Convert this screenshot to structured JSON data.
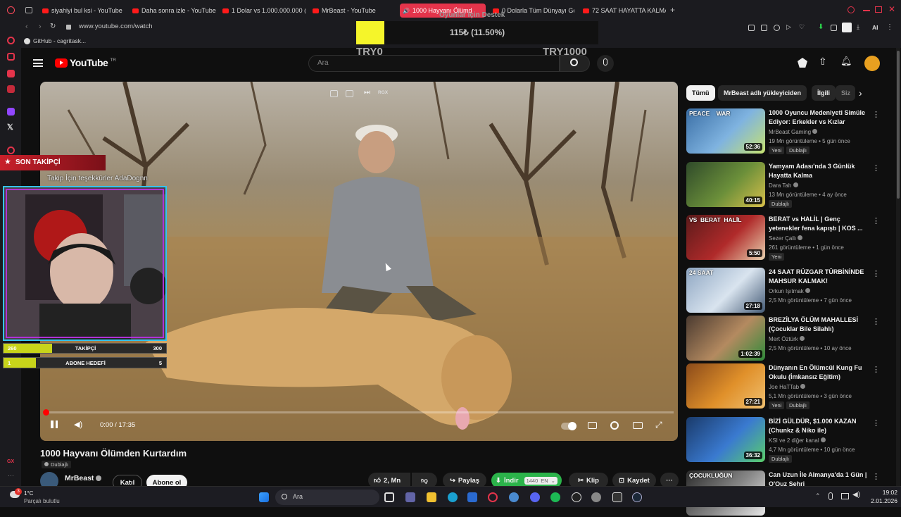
{
  "browser": {
    "tabs": [
      {
        "label": "siyahiyi bul ksi - YouTube"
      },
      {
        "label": "Daha sonra izle - YouTube"
      },
      {
        "label": "1 Dolar vs 1.000.000.000 ("
      },
      {
        "label": "MrBeast - YouTube"
      },
      {
        "label": "1000 Hayvanı Ölümd"
      },
      {
        "label": "0 Dolarla Tüm Dünyayı Ge"
      },
      {
        "label": "72 SAAT HAYATTA KALMA"
      }
    ],
    "url": "www.youtube.com/watch",
    "bookmark": "GitHub - cagritask...",
    "ai_label": "AI"
  },
  "donation": {
    "title": "Oyunlar İçin Destek",
    "amount": "115₺ (11.50%)",
    "progress": 0.115,
    "min_label": "TRY0",
    "max_label": "TRY1000"
  },
  "youtube": {
    "logo_text": "YouTube",
    "logo_region": "TR",
    "search_placeholder": "Ara",
    "video": {
      "title": "1000 Hayvanı Ölümden Kurtardım",
      "dub_label": "Dublajlı",
      "time": "0:00 / 17:35",
      "channel": "MrBeast",
      "join_label": "Katıl",
      "subscribe_label": "Abone ol",
      "likes": "2,  Mn",
      "share_label": "Paylaş",
      "download_label": "İndir",
      "download_quality": "1440",
      "download_lang": "EN",
      "clip_label": "Klip",
      "save_label": "Kaydet"
    },
    "chips": [
      "Tümü",
      "MrBeast adlı yükleyiciden",
      "İlgili",
      "Siz"
    ],
    "recommendations": [
      {
        "title": "1000 Oyuncu Medeniyeti Simüle Ediyor: Erkekler vs Kızlar",
        "channel": "MrBeast Gaming",
        "meta": "19 Mn görüntüleme • 5 gün önce",
        "badges": [
          "Yeni",
          "Dublajlı"
        ],
        "duration": "52:36",
        "thumb_text": "PEACE    WAR",
        "colors": [
          "#3a6ea5",
          "#7fb3e0",
          "#c6e26f"
        ]
      },
      {
        "title": "Yamyam Adası'nda 3 Günlük Hayatta Kalma",
        "channel": "Dara Tah",
        "meta": "13 Mn görüntüleme • 4 ay önce",
        "badges": [
          "Dublajlı"
        ],
        "duration": "40:15",
        "thumb_text": "",
        "colors": [
          "#2f4a2a",
          "#6b8f3a",
          "#d8c04a"
        ]
      },
      {
        "title": "BERAT vs HALİL | Genç yetenekler fena kapıştı | KOS ...",
        "channel": "Sezer Çallı",
        "meta": "261 görüntüleme • 1 gün önce",
        "badges": [
          "Yeni"
        ],
        "duration": "5:50",
        "thumb_text": "VS  BERAT  HALİL",
        "colors": [
          "#5a1a1a",
          "#b02a2a",
          "#e8d2b0"
        ]
      },
      {
        "title": "24 SAAT RÜZGAR TÜRBİNİNDE MAHSUR KALMAK!",
        "channel": "Orkun Işıtmak",
        "meta": "2,5 Mn görüntüleme • 7 gün önce",
        "badges": [],
        "duration": "27:18",
        "thumb_text": "24 SAAT",
        "colors": [
          "#8ea6c2",
          "#d9e4ef",
          "#445a75"
        ]
      },
      {
        "title": "BREZİLYA ÖLÜM MAHALLESİ (Çocuklar Bile Silahlı)",
        "channel": "Mert Öztürk",
        "meta": "2,5 Mn görüntüleme • 10 ay önce",
        "badges": [],
        "duration": "1:02:39",
        "thumb_text": "",
        "colors": [
          "#4a3a30",
          "#b48a60",
          "#2f8a3a"
        ]
      },
      {
        "title": "Dünyanın En Ölümcül Kung Fu Okulu (İmkansız Eğitim)",
        "channel": "Joe HaTTab",
        "meta": "5,1 Mn görüntüleme • 3 gün önce",
        "badges": [
          "Yeni",
          "Dublajlı"
        ],
        "duration": "27:21",
        "thumb_text": "",
        "colors": [
          "#8a4a1a",
          "#e0902a",
          "#f0c070"
        ]
      },
      {
        "title": "BİZİ GÜLDÜR, $1.000 KAZAN (Chunkz & Niko ile)",
        "channel": "KSI",
        "meta": "4,7 Mn görüntüleme • 10 gün önce",
        "badges": [
          "Dublajlı"
        ],
        "duration": "36:32",
        "thumb_text": "",
        "colors": [
          "#1a3a6a",
          "#3a7ad0",
          "#5acf6a"
        ]
      },
      {
        "title": "Can Uzun İle Almanya'da 1 Gün | O'Quz Sehri",
        "channel": "",
        "meta": "",
        "badges": [],
        "duration": "",
        "thumb_text": "ÇOCUKLUĞUN",
        "colors": [
          "#2a2a2a",
          "#888",
          "#e8e8e8"
        ]
      }
    ],
    "channel_suffix_4": "ve 2 diğer kanal"
  },
  "stream_overlay": {
    "follow_title": "SON TAKİPÇİ",
    "follow_thanks": "Takip İçin teşekkürler AdaDognn",
    "follower_bar": {
      "label": "TAKİPÇİ",
      "current": "260",
      "goal": "300",
      "progress": 0.3
    },
    "sub_bar": {
      "label": "ABONE HEDEFİ",
      "current": "1",
      "goal": "5",
      "progress": 0.2
    }
  },
  "taskbar": {
    "weather_temp": "1°C",
    "weather_desc": "Parçalı bulutlu",
    "notification_count": "3",
    "search_label": "Ara",
    "time": "19:02",
    "date": "2.01.2026"
  },
  "colors": {
    "accent": "#ff0000",
    "donation_yellow": "#f5f52a",
    "download_green": "#2bb34a",
    "overlay_red": "#c8202a",
    "overlay_purple": "#b032d8",
    "overlay_cyan": "#33c4f0",
    "bar_yellow": "#c8d41a"
  }
}
